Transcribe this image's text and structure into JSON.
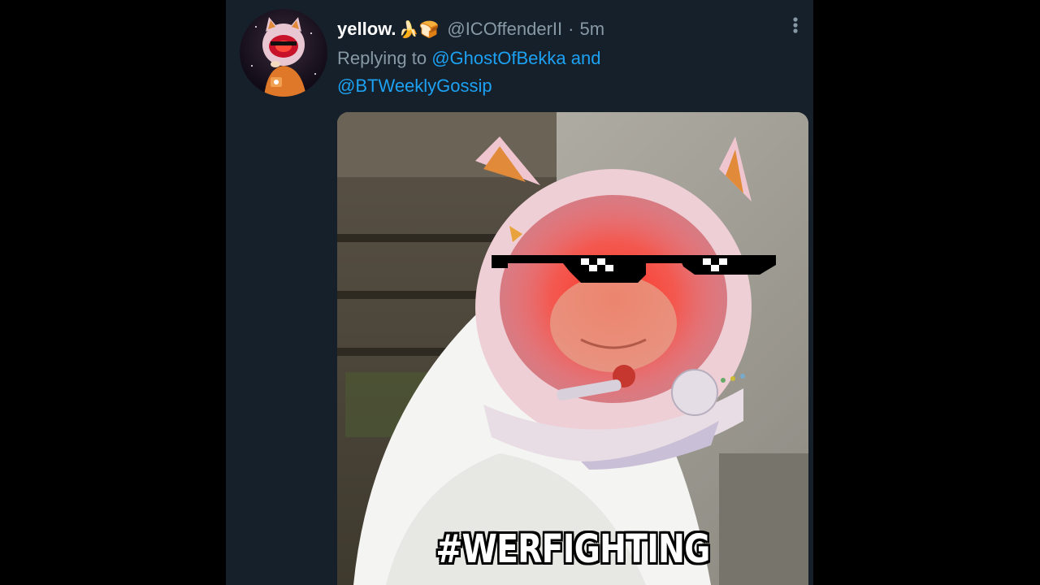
{
  "tweet": {
    "display_name": "yellow.",
    "name_emojis": "🍌🍞",
    "handle": "@ICOffenderII",
    "separator": "·",
    "timestamp": "5m",
    "replying_to_prefix": "Replying to",
    "mention_1": "@GhostOfBekka",
    "conjunction": "and",
    "mention_2": "@BTWeeklyGossip",
    "image_caption": "#WERFIGHTING"
  },
  "colors": {
    "background": "#15202b",
    "text_primary": "#ffffff",
    "text_secondary": "#8899a6",
    "link": "#1da1f2"
  },
  "icons": {
    "more": "more-vertical-icon"
  }
}
